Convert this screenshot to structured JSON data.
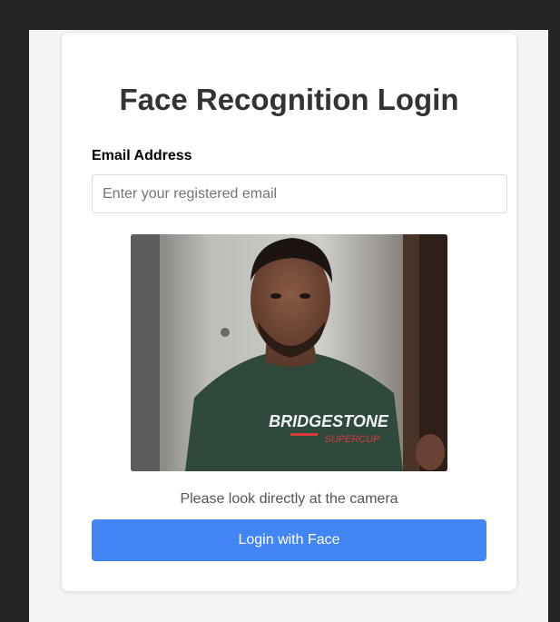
{
  "login": {
    "title": "Face Recognition Login",
    "email_label": "Email Address",
    "email_placeholder": "Enter your registered email",
    "email_value": "",
    "status_text": "Please look directly at the camera",
    "login_button": "Login with Face"
  },
  "camera_feed": {
    "shirt_text": "BRIDGESTONE",
    "shirt_subtext": "SUPERCUP"
  },
  "colors": {
    "background": "#242424",
    "page": "#f4f4f4",
    "card": "#ffffff",
    "primary": "#4285f4"
  }
}
